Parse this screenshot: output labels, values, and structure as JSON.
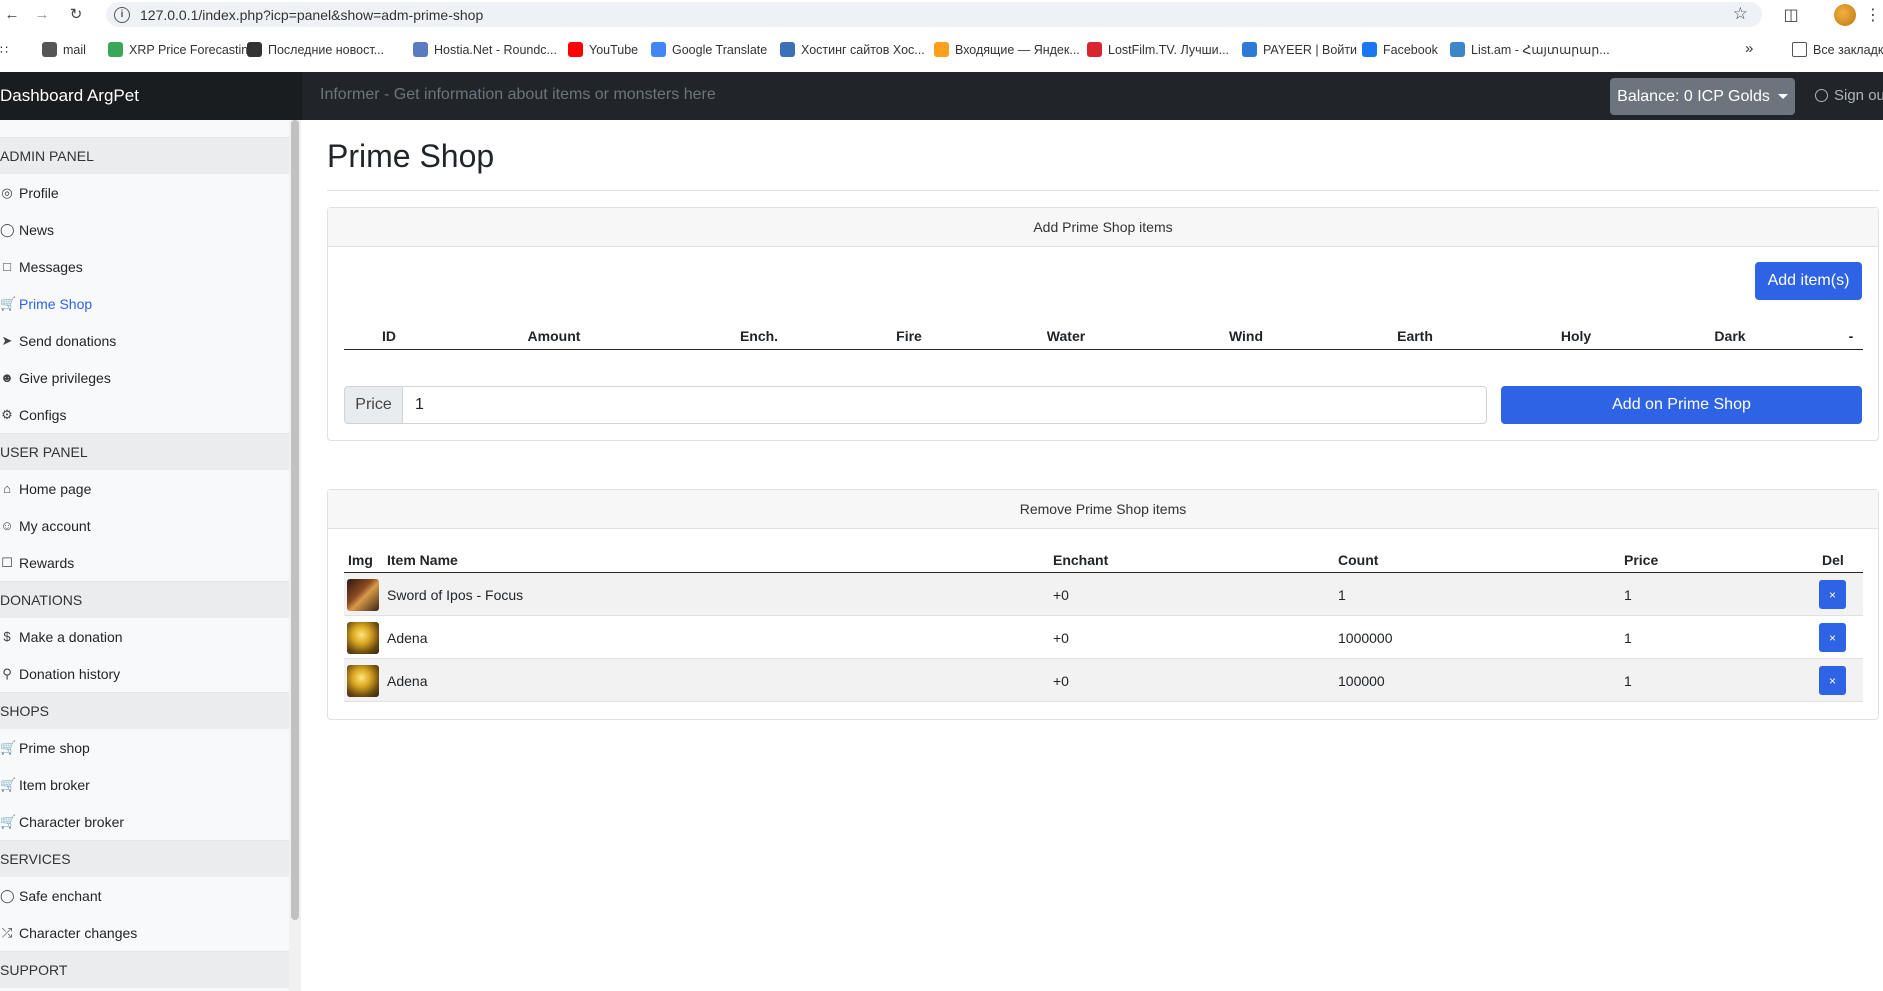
{
  "browser": {
    "url": "127.0.0.1/index.php?icp=panel&show=adm-prime-shop",
    "bookmarks": [
      {
        "label": "mail",
        "color": "#555555"
      },
      {
        "label": "XRP Price Forecastin...",
        "color": "#3aa657"
      },
      {
        "label": "Последние новост...",
        "color": "#333333"
      },
      {
        "label": "Hostia.Net - Roundc...",
        "color": "#5a7bbf"
      },
      {
        "label": "YouTube",
        "color": "#ff0000"
      },
      {
        "label": "Google Translate",
        "color": "#4285f4"
      },
      {
        "label": "Хостинг сайтов Хос...",
        "color": "#3b6fb6"
      },
      {
        "label": "Входящие — Яндек...",
        "color": "#ff9f1c"
      },
      {
        "label": "LostFilm.TV. Лучши...",
        "color": "#d7262d"
      },
      {
        "label": "PAYEER | Войти",
        "color": "#2d7ad6"
      },
      {
        "label": "Facebook",
        "color": "#1877f2"
      },
      {
        "label": "List.am - Հայտարար...",
        "color": "#3a86c9"
      }
    ],
    "all_bookmarks": "Все закладки"
  },
  "header": {
    "brand": "Dashboard ArgPet",
    "informer_placeholder": "Informer - Get information about items or monsters here",
    "balance": "Balance: 0 ICP Golds",
    "signout": "Sign out"
  },
  "sidebar": {
    "sections": [
      {
        "title": "ADMIN PANEL",
        "items": [
          {
            "label": "Profile",
            "icon": "camera-icon"
          },
          {
            "label": "News",
            "icon": "globe-icon"
          },
          {
            "label": "Messages",
            "icon": "message-icon"
          },
          {
            "label": "Prime Shop",
            "icon": "cart-icon",
            "active": true
          },
          {
            "label": "Send donations",
            "icon": "send-icon"
          },
          {
            "label": "Give privileges",
            "icon": "user-plus-icon"
          },
          {
            "label": "Configs",
            "icon": "gear-icon"
          }
        ]
      },
      {
        "title": "USER PANEL",
        "items": [
          {
            "label": "Home page",
            "icon": "home-icon"
          },
          {
            "label": "My account",
            "icon": "user-icon"
          },
          {
            "label": "Rewards",
            "icon": "gift-icon"
          }
        ]
      },
      {
        "title": "DONATIONS",
        "items": [
          {
            "label": "Make a donation",
            "icon": "dollar-icon"
          },
          {
            "label": "Donation history",
            "icon": "search-icon"
          }
        ]
      },
      {
        "title": "SHOPS",
        "items": [
          {
            "label": "Prime shop",
            "icon": "cart-icon"
          },
          {
            "label": "Item broker",
            "icon": "cart-icon"
          },
          {
            "label": "Character broker",
            "icon": "cart-icon"
          }
        ]
      },
      {
        "title": "SERVICES",
        "items": [
          {
            "label": "Safe enchant",
            "icon": "shield-icon"
          },
          {
            "label": "Character changes",
            "icon": "shuffle-icon"
          }
        ]
      },
      {
        "title": "SUPPORT",
        "items": []
      }
    ]
  },
  "main": {
    "title": "Prime Shop",
    "add_card": {
      "header": "Add Prime Shop items",
      "add_items_btn": "Add item(s)",
      "columns": [
        "ID",
        "Amount",
        "Ench.",
        "Fire",
        "Water",
        "Wind",
        "Earth",
        "Holy",
        "Dark",
        "-"
      ],
      "price_label": "Price",
      "price_value": "1",
      "submit_btn": "Add on Prime Shop"
    },
    "remove_card": {
      "header": "Remove Prime Shop items",
      "columns": {
        "img": "Img",
        "name": "Item Name",
        "enchant": "Enchant",
        "count": "Count",
        "price": "Price",
        "del": "Del"
      },
      "rows": [
        {
          "name": "Sword of Ipos - Focus",
          "enchant": "+0",
          "count": "1",
          "price": "1",
          "img": "sword"
        },
        {
          "name": "Adena",
          "enchant": "+0",
          "count": "1000000",
          "price": "1",
          "img": "adena"
        },
        {
          "name": "Adena",
          "enchant": "+0",
          "count": "100000",
          "price": "1",
          "img": "adena"
        }
      ],
      "del_label": "×"
    }
  }
}
